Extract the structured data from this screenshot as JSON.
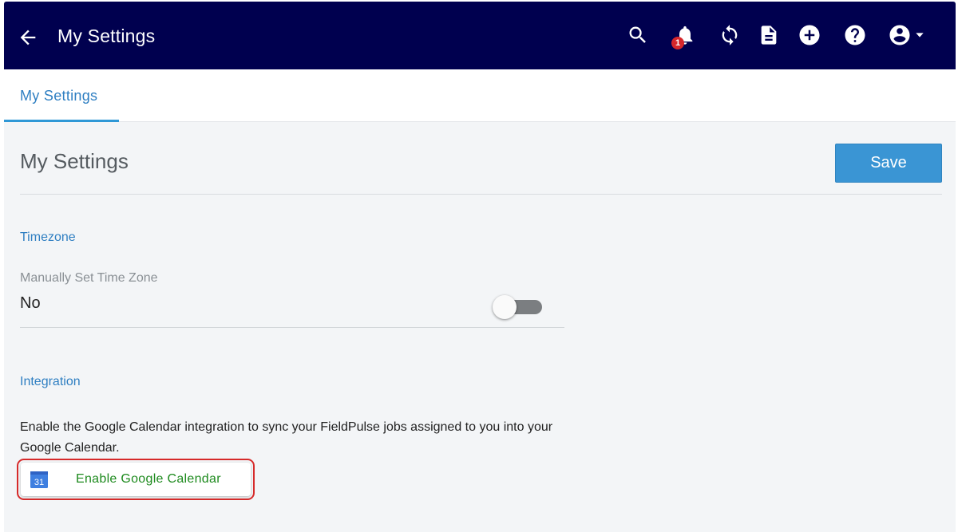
{
  "header": {
    "title": "My Settings",
    "notification_count": "1",
    "icons": [
      "back-arrow-icon",
      "search-icon",
      "bell-icon",
      "sync-icon",
      "document-icon",
      "add-circle-icon",
      "help-icon",
      "account-icon",
      "caret-down-icon"
    ]
  },
  "tabs": [
    {
      "label": "My Settings",
      "active": true
    }
  ],
  "page": {
    "title": "My Settings",
    "save_label": "Save"
  },
  "timezone": {
    "section_label": "Timezone",
    "field_label": "Manually Set Time Zone",
    "field_value": "No",
    "toggle_on": false
  },
  "integration": {
    "section_label": "Integration",
    "description": "Enable the Google Calendar integration to sync your FieldPulse jobs assigned to you into your Google Calendar.",
    "button_label": "Enable Google Calendar",
    "calendar_day": "31"
  },
  "colors": {
    "navbar_bg": "#00004f",
    "accent_blue": "#2f7fc2",
    "save_bg": "#3a95d4",
    "badge_red": "#d6262b",
    "highlight_red": "#d62a2a",
    "google_green": "#1d8a1d"
  }
}
